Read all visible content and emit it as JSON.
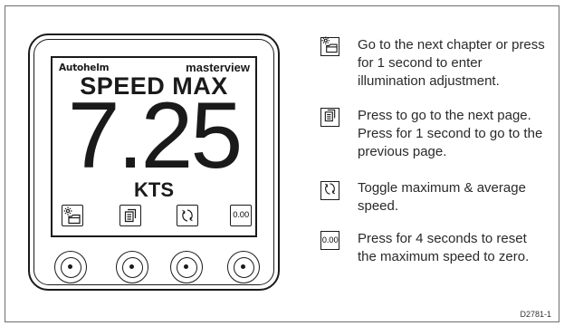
{
  "display": {
    "brand": "Autohelm",
    "product": "masterview",
    "mode_label": "SPEED MAX",
    "value": "7.25",
    "unit": "KTS",
    "softkeys": [
      {
        "icon": "chapter-illumination-icon"
      },
      {
        "icon": "page-icon"
      },
      {
        "icon": "toggle-cycle-icon"
      },
      {
        "icon": "reset-zero-icon",
        "text": "0.00"
      }
    ]
  },
  "legend": [
    {
      "icon": "chapter-illumination-icon",
      "text": "Go to the next chapter or press for 1 second to enter illumination adjustment."
    },
    {
      "icon": "page-icon",
      "text": "Press to go to the next page. Press for 1 second to go to the previous page."
    },
    {
      "icon": "toggle-cycle-icon",
      "text": "Toggle maximum & average speed."
    },
    {
      "icon": "reset-zero-icon",
      "text": "Press for 4 seconds to reset the maximum speed to zero.",
      "icon_text": "0.00"
    }
  ],
  "figure_ref": "D2781-1"
}
